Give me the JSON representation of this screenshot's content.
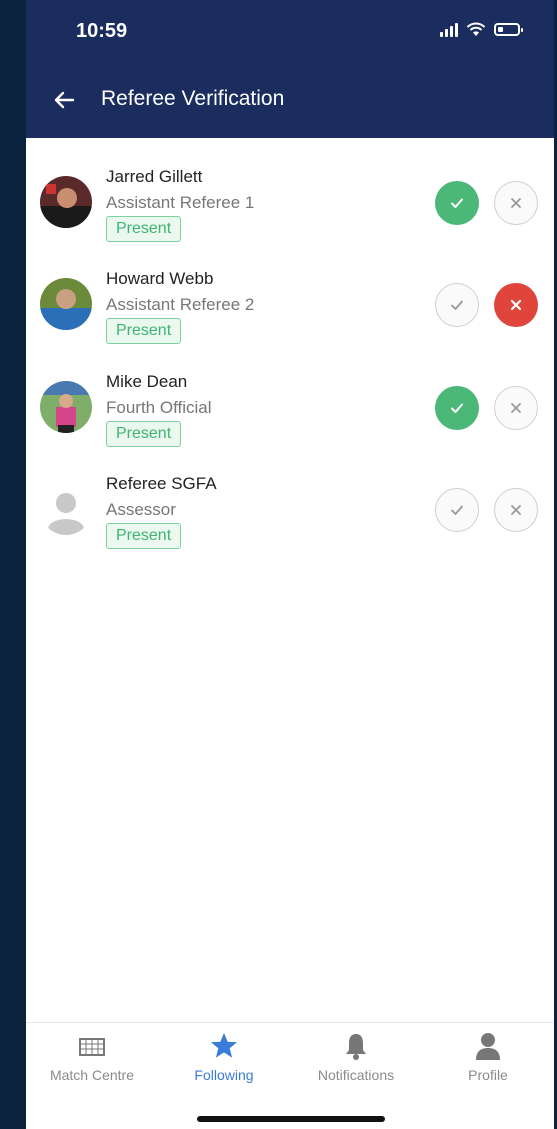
{
  "status_bar": {
    "time": "10:59"
  },
  "header": {
    "title": "Referee Verification"
  },
  "officials": [
    {
      "name": "Jarred Gillett",
      "role": "Assistant Referee 1",
      "status": "Present",
      "check_active": true,
      "cross_active": false,
      "avatar": "photo"
    },
    {
      "name": "Howard Webb",
      "role": "Assistant Referee 2",
      "status": "Present",
      "check_active": false,
      "cross_active": true,
      "avatar": "photo"
    },
    {
      "name": "Mike Dean",
      "role": "Fourth Official",
      "status": "Present",
      "check_active": true,
      "cross_active": false,
      "avatar": "photo"
    },
    {
      "name": "Referee SGFA",
      "role": "Assessor",
      "status": "Present",
      "check_active": false,
      "cross_active": false,
      "avatar": "placeholder"
    }
  ],
  "tabs": [
    {
      "label": "Match Centre",
      "icon": "goal-net-icon",
      "active": false
    },
    {
      "label": "Following",
      "icon": "star-icon",
      "active": true
    },
    {
      "label": "Notifications",
      "icon": "bell-icon",
      "active": false
    },
    {
      "label": "Profile",
      "icon": "person-icon",
      "active": false
    }
  ],
  "colors": {
    "header_bg": "#1b2d5e",
    "confirm_green": "#4cb877",
    "reject_red": "#e0453c",
    "present_badge": "#3fb472",
    "active_tab": "#3a7bd5"
  }
}
